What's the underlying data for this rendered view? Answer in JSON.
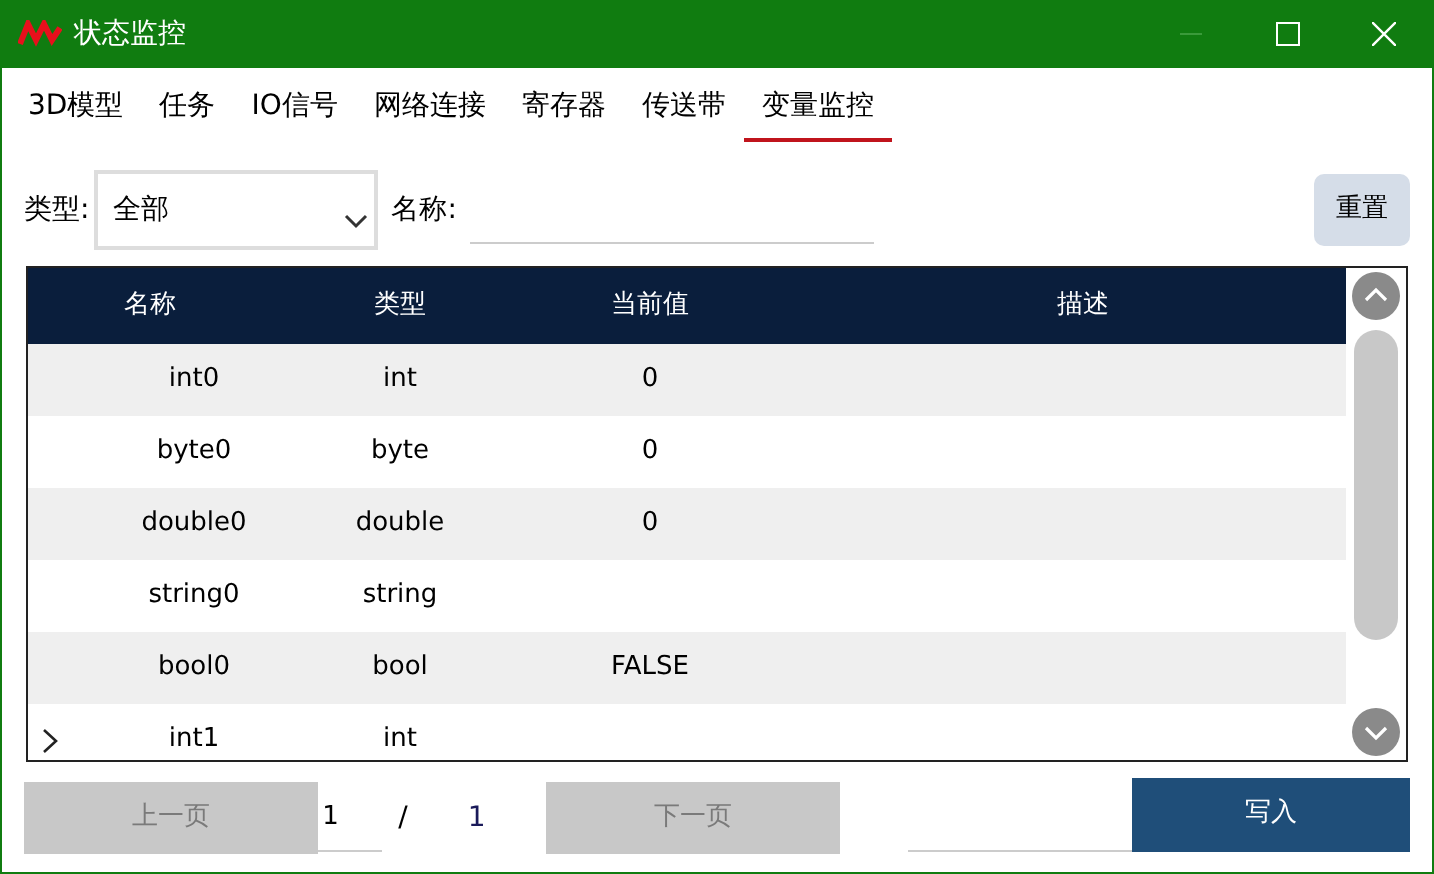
{
  "window": {
    "title": "状态监控"
  },
  "tabs": [
    {
      "label": "3D模型",
      "selected": false
    },
    {
      "label": "任务",
      "selected": false
    },
    {
      "label": "IO信号",
      "selected": false
    },
    {
      "label": "网络连接",
      "selected": false
    },
    {
      "label": "寄存器",
      "selected": false
    },
    {
      "label": "传送带",
      "selected": false
    },
    {
      "label": "变量监控",
      "selected": true
    }
  ],
  "filter": {
    "type_label": "类型:",
    "type_value": "全部",
    "name_label": "名称:",
    "reset_button": "重置"
  },
  "table": {
    "columns": [
      "名称",
      "类型",
      "当前值",
      "描述"
    ],
    "rows": [
      {
        "cells": [
          "int0",
          "int",
          "0",
          ""
        ],
        "current": false
      },
      {
        "cells": [
          "byte0",
          "byte",
          "0",
          ""
        ],
        "current": false
      },
      {
        "cells": [
          "double0",
          "double",
          "0",
          ""
        ],
        "current": false
      },
      {
        "cells": [
          "string0",
          "string",
          "",
          ""
        ],
        "current": false
      },
      {
        "cells": [
          "bool0",
          "bool",
          "FALSE",
          ""
        ],
        "current": false
      },
      {
        "cells": [
          "int1",
          "int",
          "",
          ""
        ],
        "current": true
      }
    ]
  },
  "pager": {
    "prev": {
      "label": "上一页",
      "disabled": true
    },
    "page": "1",
    "separator": "/",
    "total": "1",
    "next": {
      "label": "下一页",
      "disabled": true
    }
  },
  "write_button": "写入"
}
